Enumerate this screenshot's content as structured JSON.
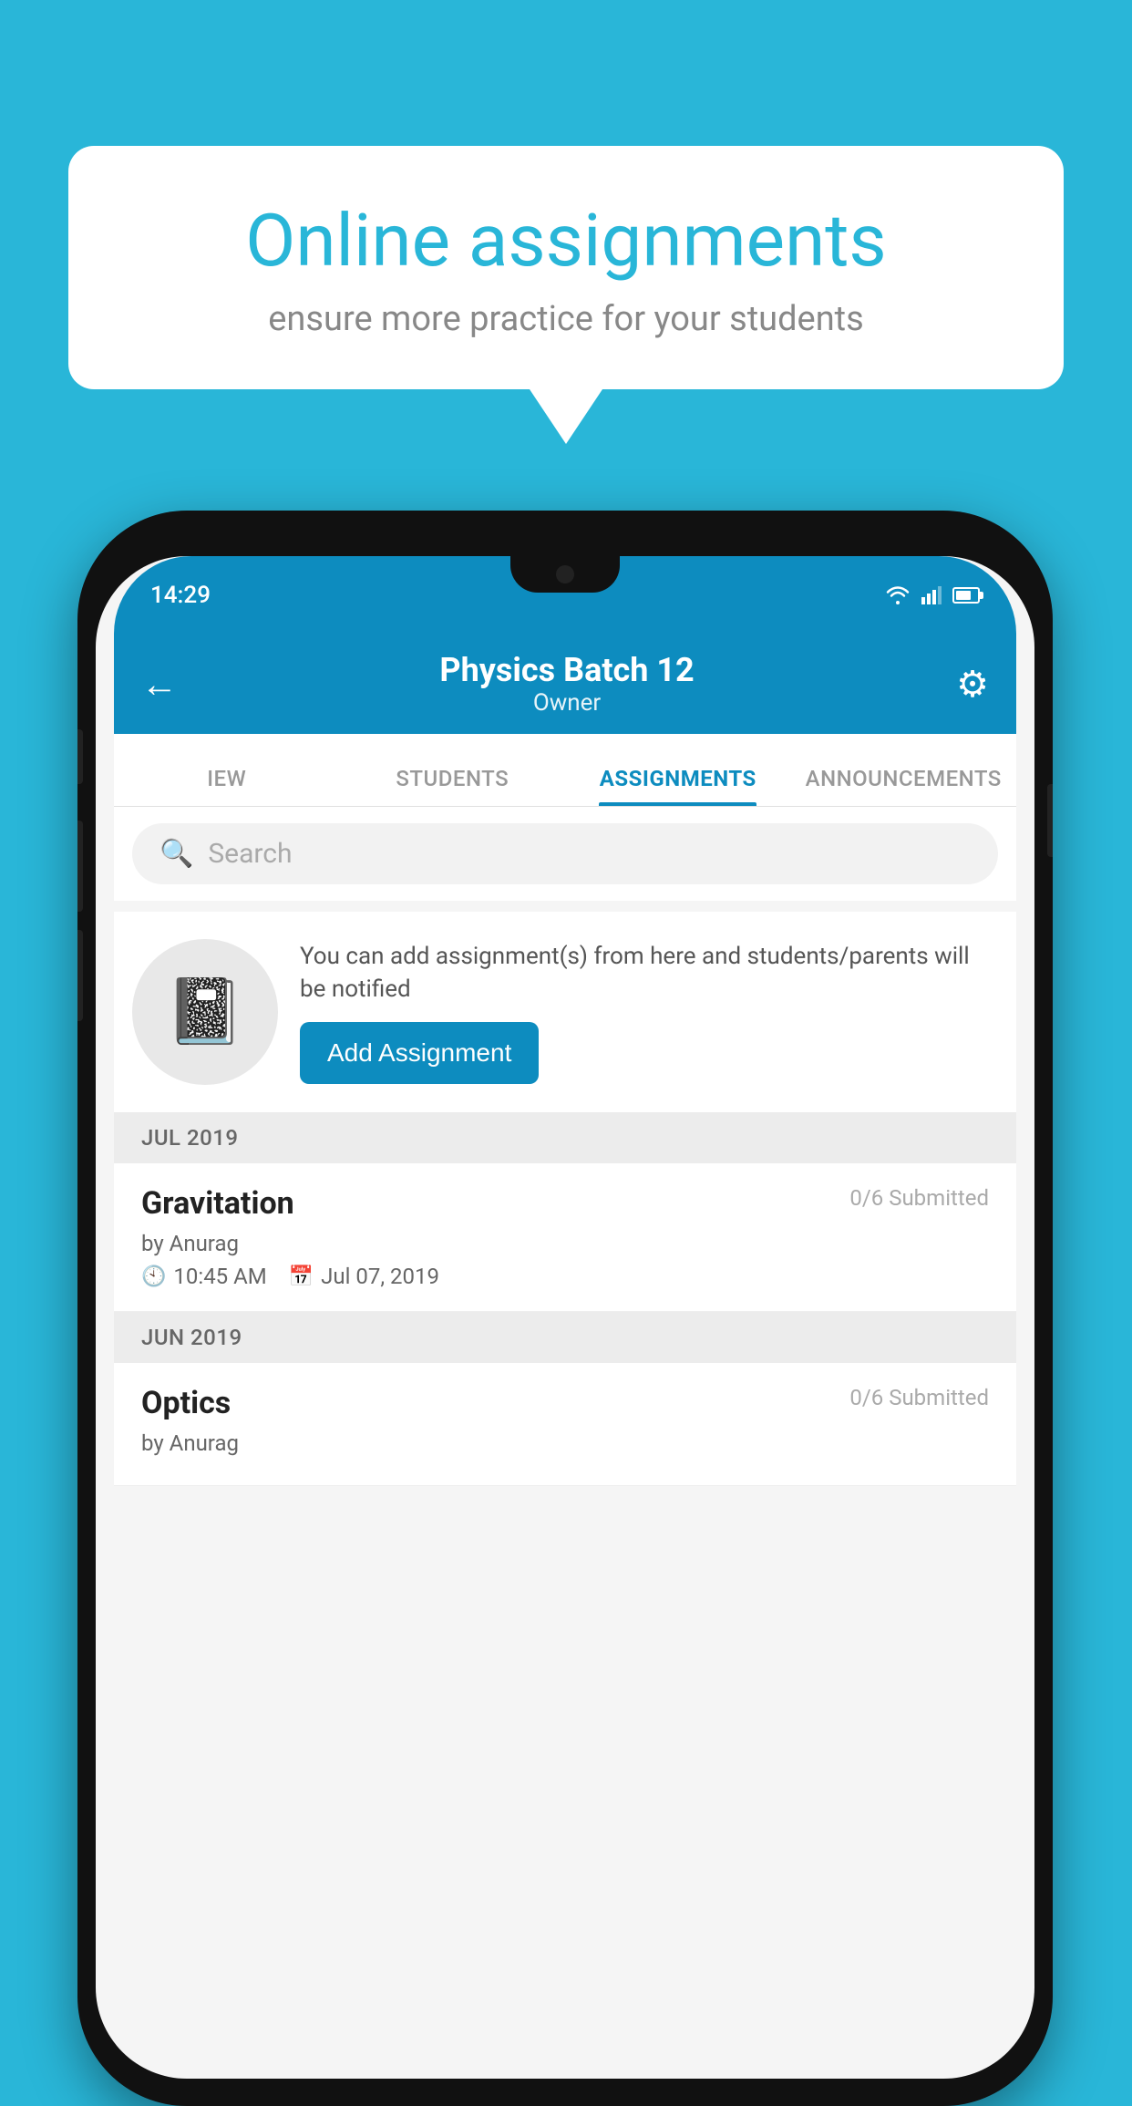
{
  "background": {
    "color": "#29b6d8"
  },
  "speech_bubble": {
    "title": "Online assignments",
    "subtitle": "ensure more practice for your students"
  },
  "status_bar": {
    "time": "14:29"
  },
  "app_header": {
    "title": "Physics Batch 12",
    "subtitle": "Owner",
    "back_label": "←",
    "gear_label": "⚙"
  },
  "tabs": [
    {
      "label": "IEW",
      "active": false
    },
    {
      "label": "STUDENTS",
      "active": false
    },
    {
      "label": "ASSIGNMENTS",
      "active": true
    },
    {
      "label": "ANNOUNCEMENTS",
      "active": false
    }
  ],
  "search": {
    "placeholder": "Search"
  },
  "promo": {
    "icon": "📓",
    "description": "You can add assignment(s) from here and students/parents will be notified",
    "button_label": "Add Assignment"
  },
  "sections": [
    {
      "label": "JUL 2019",
      "assignments": [
        {
          "name": "Gravitation",
          "submitted": "0/6 Submitted",
          "by": "by Anurag",
          "time": "10:45 AM",
          "date": "Jul 07, 2019"
        }
      ]
    },
    {
      "label": "JUN 2019",
      "assignments": [
        {
          "name": "Optics",
          "submitted": "0/6 Submitted",
          "by": "by Anurag",
          "time": "",
          "date": ""
        }
      ]
    }
  ]
}
